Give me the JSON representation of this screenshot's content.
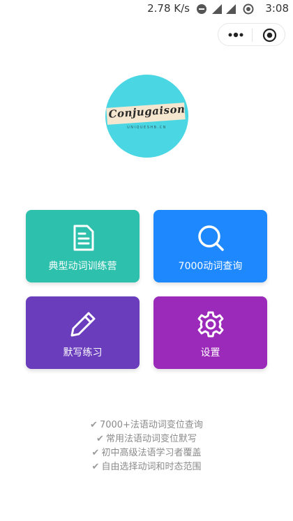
{
  "status_bar": {
    "speed": "2.78 K/s",
    "network": "4G",
    "time": "3:08"
  },
  "capsule": {
    "more_icon": "more-dots-icon",
    "close_icon": "target-circle-icon"
  },
  "logo": {
    "title": "Conjugaison",
    "subtitle": "UNIQUESHB.CN",
    "color": "#4ad7e3"
  },
  "menu": {
    "items": [
      {
        "label": "典型动词训练营",
        "icon": "document-icon",
        "color": "#2dc0ac"
      },
      {
        "label": "7000动词查询",
        "icon": "search-icon",
        "color": "#1e88ff"
      },
      {
        "label": "默写练习",
        "icon": "pencil-icon",
        "color": "#6a3dbd"
      },
      {
        "label": "设置",
        "icon": "gear-icon",
        "color": "#9b2aba"
      }
    ]
  },
  "features": [
    "7000+法语动词变位查询",
    "常用法语动词变位默写",
    "初中高级法语学习者覆盖",
    "自由选择动词和时态范围"
  ]
}
